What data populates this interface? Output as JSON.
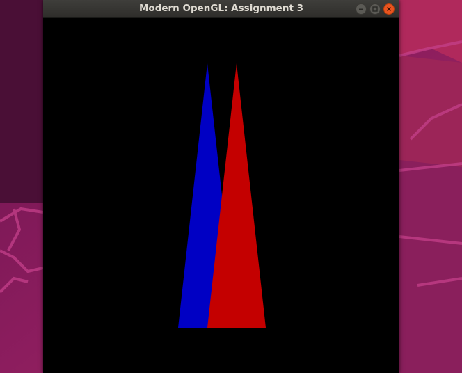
{
  "window": {
    "title": "Modern OpenGL: Assignment 3"
  },
  "controls": {
    "minimize_icon": "minimize-icon",
    "maximize_icon": "maximize-icon",
    "close_icon": "close-icon"
  },
  "scene": {
    "background_color": "#000000",
    "triangles": [
      {
        "name": "blue-triangle",
        "color": "#0000c4"
      },
      {
        "name": "red-triangle",
        "color": "#c40000"
      }
    ]
  },
  "desktop": {
    "wallpaper_colors": [
      "#7a1a5a",
      "#a0285e",
      "#4a0f3a"
    ]
  }
}
